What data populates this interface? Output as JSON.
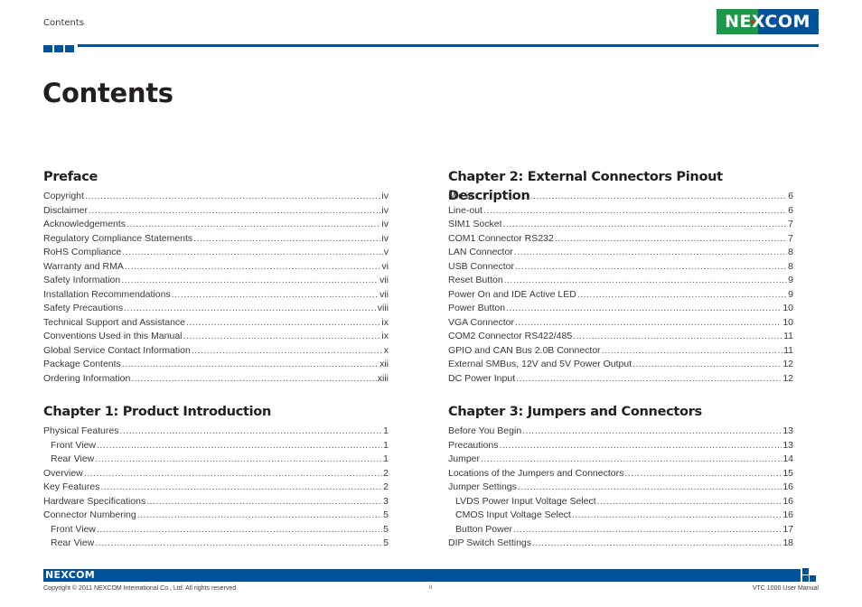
{
  "header": {
    "label": "Contents",
    "logo_text": "NEXCOM",
    "accent_color": "#00529b",
    "logo_green": "#1a9a48"
  },
  "page_title": "Contents",
  "left_column": [
    {
      "title": "Preface",
      "entries": [
        {
          "label": "Copyright",
          "page": "iv",
          "level": 1
        },
        {
          "label": "Disclaimer",
          "page": "iv",
          "level": 1
        },
        {
          "label": "Acknowledgements",
          "page": "iv",
          "level": 1
        },
        {
          "label": "Regulatory Compliance Statements",
          "page": "iv",
          "level": 1
        },
        {
          "label": "RoHS Compliance",
          "page": "v",
          "level": 1
        },
        {
          "label": "Warranty and RMA",
          "page": "vi",
          "level": 1
        },
        {
          "label": "Safety Information",
          "page": "vii",
          "level": 1
        },
        {
          "label": "Installation Recommendations",
          "page": "vii",
          "level": 1
        },
        {
          "label": "Safety Precautions",
          "page": "viii",
          "level": 1
        },
        {
          "label": "Technical Support and Assistance",
          "page": "ix",
          "level": 1
        },
        {
          "label": "Conventions Used in this Manual",
          "page": "ix",
          "level": 1
        },
        {
          "label": "Global Service Contact Information",
          "page": "x",
          "level": 1
        },
        {
          "label": "Package Contents",
          "page": "xii",
          "level": 1
        },
        {
          "label": "Ordering Information",
          "page": "xiii",
          "level": 1
        }
      ]
    },
    {
      "title": "Chapter 1: Product Introduction",
      "entries": [
        {
          "label": "Physical Features",
          "page": "1",
          "level": 1
        },
        {
          "label": "Front View",
          "page": "1",
          "level": 2
        },
        {
          "label": "Rear View",
          "page": "1",
          "level": 2
        },
        {
          "label": "Overview",
          "page": "2",
          "level": 1
        },
        {
          "label": "Key Features",
          "page": "2",
          "level": 1
        },
        {
          "label": "Hardware Specifications",
          "page": "3",
          "level": 1
        },
        {
          "label": "Connector Numbering",
          "page": "5",
          "level": 1
        },
        {
          "label": "Front View",
          "page": "5",
          "level": 2
        },
        {
          "label": "Rear View",
          "page": "5",
          "level": 2
        }
      ]
    }
  ],
  "right_column": [
    {
      "title": "Chapter 2: External Connectors Pinout Description",
      "entries": [
        {
          "label": "Mic-in",
          "page": "6",
          "level": 1
        },
        {
          "label": "Line-out",
          "page": "6",
          "level": 1
        },
        {
          "label": "SIM1 Socket",
          "page": "7",
          "level": 1
        },
        {
          "label": "COM1 Connector RS232",
          "page": "7",
          "level": 1
        },
        {
          "label": "LAN Connector",
          "page": "8",
          "level": 1
        },
        {
          "label": "USB Connector",
          "page": "8",
          "level": 1
        },
        {
          "label": "Reset Button",
          "page": "9",
          "level": 1
        },
        {
          "label": "Power On and IDE Active LED",
          "page": "9",
          "level": 1
        },
        {
          "label": "Power Button",
          "page": "10",
          "level": 1
        },
        {
          "label": "VGA Connector",
          "page": "10",
          "level": 1
        },
        {
          "label": "COM2 Connector RS422/485",
          "page": "11",
          "level": 1
        },
        {
          "label": "GPIO and CAN Bus 2.0B Connector",
          "page": "11",
          "level": 1
        },
        {
          "label": "External SMBus, 12V and 5V Power Output",
          "page": "12",
          "level": 1
        },
        {
          "label": "DC Power Input",
          "page": "12",
          "level": 1
        }
      ]
    },
    {
      "title": "Chapter 3: Jumpers and Connectors",
      "entries": [
        {
          "label": "Before You Begin",
          "page": "13",
          "level": 1
        },
        {
          "label": "Precautions",
          "page": "13",
          "level": 1
        },
        {
          "label": "Jumper",
          "page": "14",
          "level": 1
        },
        {
          "label": "Locations of the Jumpers and Connectors",
          "page": "15",
          "level": 1
        },
        {
          "label": "Jumper Settings",
          "page": "16",
          "level": 1
        },
        {
          "label": "LVDS Power Input Voltage Select",
          "page": "16",
          "level": 2
        },
        {
          "label": "CMOS Input Voltage Select",
          "page": "16",
          "level": 2
        },
        {
          "label": "Button Power",
          "page": "17",
          "level": 2
        },
        {
          "label": "DIP Switch Settings",
          "page": "18",
          "level": 1
        }
      ]
    }
  ],
  "footer": {
    "logo_text": "NEXCOM",
    "copyright": "Copyright © 2011 NEXCOM International Co., Ltd. All rights reserved",
    "page_number": "ii",
    "manual_name": "VTC 1000 User Manual"
  }
}
